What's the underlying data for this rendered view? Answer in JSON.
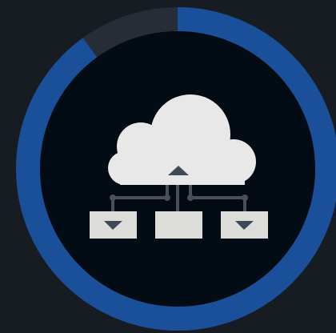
{
  "progress_ring": {
    "progress": 0.9,
    "colors": {
      "fill": "#1a4f99",
      "track": "#262d36",
      "inner": "#030b14"
    }
  },
  "emblem": {
    "icon": "cloud-network-icon",
    "colors": {
      "cloud": "#e8e8e8",
      "nodes": "#dcdcd8",
      "lines": "#4a5056",
      "arrows": "#3f4a56"
    }
  },
  "colors": {
    "background": "#171c23"
  }
}
